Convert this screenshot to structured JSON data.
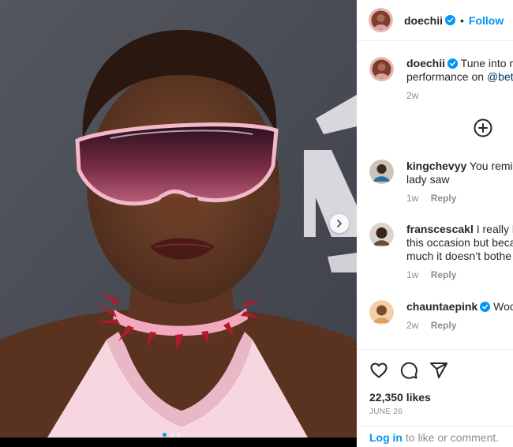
{
  "post": {
    "username": "doechii",
    "follow_label": "Follow",
    "separator": "•"
  },
  "caption": {
    "username": "doechii",
    "text_line1": "Tune into m",
    "text_line2_prefix": "performance on ",
    "mention": "@bet",
    "time": "2w"
  },
  "comments": [
    {
      "username": "kingchevyy",
      "line1": "You remir",
      "line2": "lady saw",
      "time": "1w",
      "reply": "Reply"
    },
    {
      "username": "franscescakl",
      "line1": "I really h",
      "line2": "this occasion but beca",
      "line3": "much it doesn’t bothe",
      "time": "1w",
      "reply": "Reply"
    },
    {
      "username": "chauntaepink",
      "line1": "Woo",
      "time": "2w",
      "reply": "Reply"
    }
  ],
  "stats": {
    "likes": "22,350 likes",
    "date": "JUNE 26"
  },
  "login": {
    "link": "Log in",
    "rest": " to like or comment."
  },
  "icons": {
    "verified": "verified-badge-icon",
    "next": "chevron-right-icon",
    "load_more": "plus-circle-icon",
    "like": "heart-icon",
    "comment": "comment-bubble-icon",
    "share": "paper-plane-icon"
  },
  "colors": {
    "accent": "#0095f6",
    "mention": "#00376b",
    "muted": "#8e8e8e",
    "text": "#262626"
  }
}
